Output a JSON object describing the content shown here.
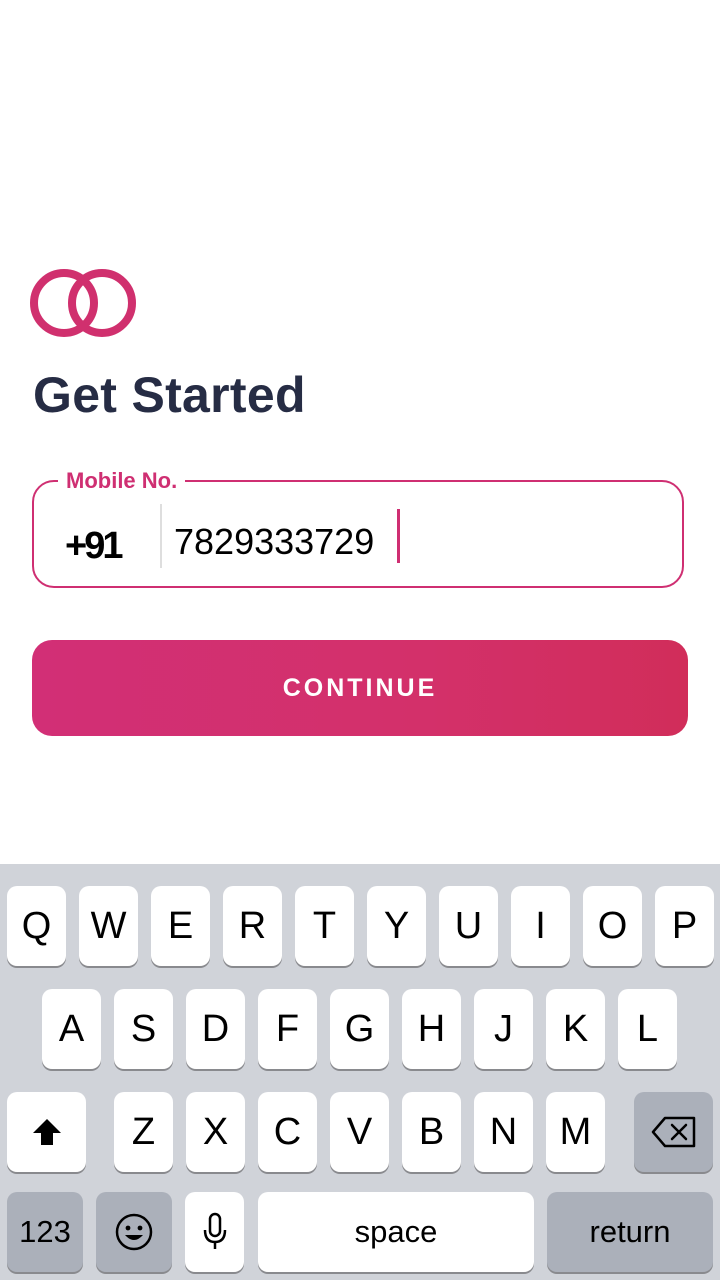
{
  "header": {
    "title": "Get Started"
  },
  "brand": {
    "accent_color": "#cf2f72",
    "logo_icon": "interlocked-rings-icon"
  },
  "phone_field": {
    "label": "Mobile No.",
    "country_code": "+91",
    "value": "7829333729"
  },
  "continue_button": {
    "label": "CONTINUE"
  },
  "keyboard": {
    "row1": [
      "Q",
      "W",
      "E",
      "R",
      "T",
      "Y",
      "U",
      "I",
      "O",
      "P"
    ],
    "row2": [
      "A",
      "S",
      "D",
      "F",
      "G",
      "H",
      "J",
      "K",
      "L"
    ],
    "row3": [
      "Z",
      "X",
      "C",
      "V",
      "B",
      "N",
      "M"
    ],
    "shift_icon": "shift-icon",
    "backspace_icon": "backspace-icon",
    "numbers_label": "123",
    "emoji_icon": "emoji-icon",
    "mic_icon": "microphone-icon",
    "space_label": "space",
    "return_label": "return"
  }
}
